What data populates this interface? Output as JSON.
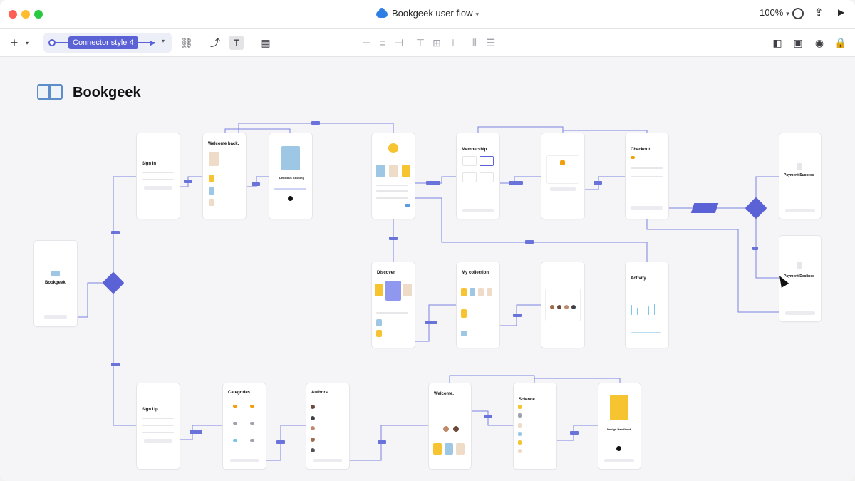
{
  "window": {
    "title": "Bookgeek user flow",
    "zoom": "100%",
    "traffic_colors": [
      "#ff5f57",
      "#febc2e",
      "#28c840"
    ]
  },
  "toolbar": {
    "connector_style": "Connector style 4",
    "add_icon": "plus-icon",
    "tools": [
      "unlink-icon",
      "connector-icon",
      "text-icon",
      "pattern-icon"
    ],
    "align_tools": [
      "align-left-icon",
      "align-center-icon",
      "align-right-icon",
      "align-top-icon",
      "align-middle-icon",
      "align-bottom-icon",
      "distribute-h-icon",
      "distribute-v-icon"
    ],
    "right_tools": [
      "layers-icon",
      "frame-icon",
      "preview-icon",
      "lock-icon"
    ]
  },
  "canvas": {
    "brand": "Bookgeek",
    "screens": [
      {
        "key": "splash",
        "title": "Bookgeek"
      },
      {
        "key": "signin",
        "title": "Sign In"
      },
      {
        "key": "welcome",
        "title": "Welcome back,"
      },
      {
        "key": "player",
        "title": "Delicious Cooking"
      },
      {
        "key": "profile",
        "title": ""
      },
      {
        "key": "membership",
        "title": "Membership"
      },
      {
        "key": "discount",
        "title": ""
      },
      {
        "key": "checkout",
        "title": "Checkout"
      },
      {
        "key": "payment_success",
        "title": "Payment Success"
      },
      {
        "key": "payment_declined",
        "title": "Payment Declined"
      },
      {
        "key": "discover",
        "title": "Discover"
      },
      {
        "key": "collection",
        "title": "My collection"
      },
      {
        "key": "followers",
        "title": ""
      },
      {
        "key": "activity",
        "title": "Activity"
      },
      {
        "key": "signup",
        "title": "Sign Up"
      },
      {
        "key": "categories",
        "title": "Categories"
      },
      {
        "key": "authors",
        "title": "Authors"
      },
      {
        "key": "welcome2",
        "title": "Welcome,"
      },
      {
        "key": "science",
        "title": "Science"
      },
      {
        "key": "design",
        "title": "Design Handbook"
      }
    ]
  },
  "colors": {
    "accent": "#5b62d6",
    "connector": "#7b83e0",
    "book_yellow": "#f6c430",
    "book_blue": "#9ec7e6",
    "book_beige": "#efdcc8"
  }
}
